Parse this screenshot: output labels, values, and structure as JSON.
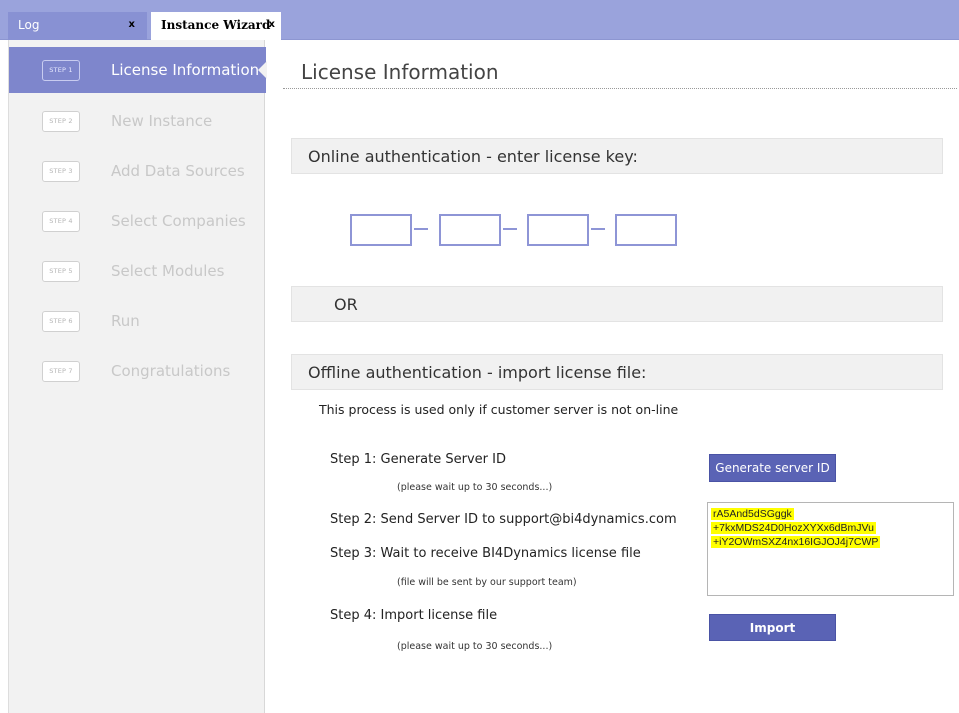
{
  "tabs": [
    {
      "label": "Log",
      "close": "x"
    },
    {
      "label": "Instance Wizard",
      "close": "x"
    }
  ],
  "sidebar": {
    "steps": [
      {
        "badge": "STEP 1",
        "label": "License Information"
      },
      {
        "badge": "STEP 2",
        "label": "New Instance"
      },
      {
        "badge": "STEP 3",
        "label": "Add Data Sources"
      },
      {
        "badge": "STEP 4",
        "label": "Select Companies"
      },
      {
        "badge": "STEP 5",
        "label": "Select Modules"
      },
      {
        "badge": "STEP 6",
        "label": "Run"
      },
      {
        "badge": "STEP 7",
        "label": "Congratulations"
      }
    ]
  },
  "main": {
    "title": "License Information",
    "online_header": "Online authentication - enter license key:",
    "license_key": [
      "",
      "",
      "",
      ""
    ],
    "or_label": "OR",
    "offline_header": "Offline authentication - import license file:",
    "offline_desc": "This process is used only if customer server is not on-line",
    "steps": {
      "step1": "Step 1: Generate Server ID",
      "step1_note": "(please wait up to 30 seconds...)",
      "step2": "Step 2: Send Server ID to support@bi4dynamics.com",
      "step3": "Step 3: Wait to receive BI4Dynamics license file",
      "step3_note": "(file will be sent by our support team)",
      "step4": "Step 4: Import license file",
      "step4_note": "(please wait up to 30 seconds...)"
    },
    "generate_button": "Generate server ID",
    "import_button": "Import",
    "server_id_lines": [
      "rA5And5dSGggk",
      "+7kxMDS24D0HozXYXx6dBmJVu",
      "+iY2OWmSXZ4nx16IGJOJ4j7CWP"
    ]
  },
  "colors": {
    "tabbar": "#9aa3dc",
    "accent": "#7e86cc",
    "button": "#5a63b5",
    "highlight": "#ffff00"
  }
}
